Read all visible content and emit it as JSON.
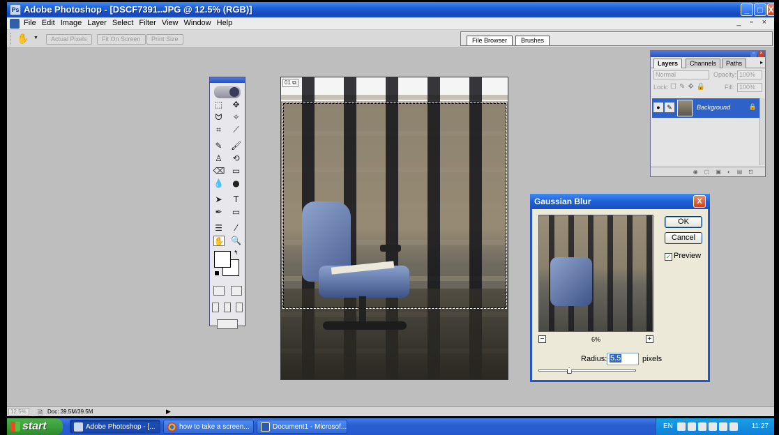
{
  "window": {
    "title": "Adobe Photoshop - [DSCF7391..JPG @ 12.5% (RGB)]",
    "controls": {
      "minimize": "_",
      "maximize": "□",
      "close": "X"
    }
  },
  "menubar": {
    "items": [
      "File",
      "Edit",
      "Image",
      "Layer",
      "Select",
      "Filter",
      "View",
      "Window",
      "Help"
    ],
    "mdi_controls": "_ ▫ ×"
  },
  "options_bar": {
    "tool_icon": "hand-icon",
    "buttons": {
      "actual_pixels": "Actual Pixels",
      "fit_on_screen": "Fit On Screen",
      "print_size": "Print Size"
    },
    "palette_well_tabs": [
      "File Browser",
      "Brushes"
    ]
  },
  "document": {
    "tag": "01 ⧉"
  },
  "layers_palette": {
    "tabs": [
      "Layers",
      "Channels",
      "Paths"
    ],
    "blend_mode": "Normal",
    "opacity_label": "Opacity:",
    "opacity_value": "100%",
    "lock_label": "Lock:",
    "fill_label": "Fill:",
    "fill_value": "100%",
    "layer": {
      "name": "Background",
      "visible": "●",
      "lock": "🔒"
    }
  },
  "gaussian_blur": {
    "title": "Gaussian Blur",
    "close": "X",
    "ok": "OK",
    "cancel": "Cancel",
    "preview_label": "Preview",
    "preview_checked": "✓",
    "zoom_minus": "−",
    "zoom_plus": "+",
    "zoom_percent": "6%",
    "radius_label": "Radius:",
    "radius_value": "5.5",
    "radius_unit": "pixels",
    "slider_level": 0.3
  },
  "statusbar": {
    "zoom": "12.5%",
    "doc_size": "Doc: 39.5M/39.5M",
    "arrow": "▶"
  },
  "taskbar": {
    "start": "start",
    "tasks": [
      "Adobe Photoshop - [...",
      "how to take a screen...",
      "Document1 - Microsof..."
    ],
    "language": "EN",
    "clock": "11:27"
  },
  "colors": {
    "titlebar": "#1f5fd6",
    "workspace": "#bebebe",
    "dialog": "#ece9d8",
    "selected_layer": "#2e62c8",
    "taskbar": "#2a5fd0",
    "start_button": "#2d8a2d"
  }
}
